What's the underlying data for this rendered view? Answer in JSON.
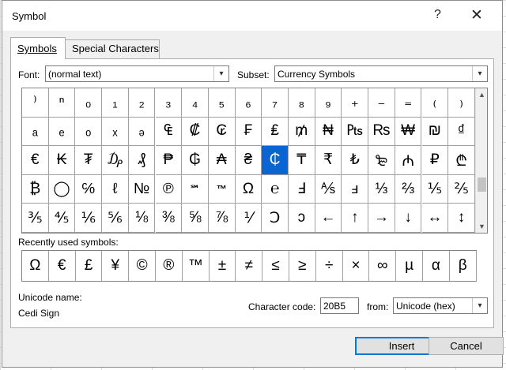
{
  "dialog": {
    "title": "Symbol",
    "help_glyph": "?",
    "close_glyph": "✕"
  },
  "tabs": [
    {
      "label": "Symbols",
      "active": true
    },
    {
      "label": "Special Characters",
      "active": false
    }
  ],
  "font": {
    "label": "Font:",
    "value": "(normal text)"
  },
  "subset": {
    "label": "Subset:",
    "value": "Currency Symbols"
  },
  "symbol_grid": {
    "rows": [
      [
        "⁾",
        "ⁿ",
        "₀",
        "₁",
        "₂",
        "₃",
        "₄",
        "₅",
        "₆",
        "₇",
        "₈",
        "₉",
        "₊",
        "₋",
        "₌",
        "₍",
        "₎"
      ],
      [
        "ₐ",
        "ₑ",
        "ₒ",
        "ₓ",
        "ₔ",
        "₠",
        "₡",
        "₢",
        "₣",
        "₤",
        "₥",
        "₦",
        "₧",
        "₨",
        "₩",
        "₪",
        "₫"
      ],
      [
        "€",
        "₭",
        "₮",
        "₯",
        "₰",
        "₱",
        "₲",
        "₳",
        "₴",
        "₵",
        "₸",
        "₹",
        "₺",
        "₻",
        "₼",
        "₽",
        "₾"
      ],
      [
        "₿",
        "◯",
        "℅",
        "ℓ",
        "№",
        "℗",
        "℠",
        "™",
        "Ω",
        "℮",
        "Ⅎ",
        "⅍",
        "ⅎ",
        "⅓",
        "⅔",
        "⅕",
        "⅖"
      ],
      [
        "⅗",
        "⅘",
        "⅙",
        "⅚",
        "⅛",
        "⅜",
        "⅝",
        "⅞",
        "⅟",
        "Ↄ",
        "ↄ",
        "←",
        "↑",
        "→",
        "↓",
        "↔",
        "↕"
      ]
    ],
    "selected": "₵"
  },
  "recent": {
    "label": "Recently used symbols:",
    "symbols": [
      "Ω",
      "€",
      "£",
      "¥",
      "©",
      "®",
      "™",
      "±",
      "≠",
      "≤",
      "≥",
      "÷",
      "×",
      "∞",
      "µ",
      "α",
      "β"
    ]
  },
  "unicode_name": {
    "label": "Unicode name:",
    "value": "Cedi Sign"
  },
  "character_code": {
    "label": "Character code:",
    "value": "20B5"
  },
  "from": {
    "label": "from:",
    "value": "Unicode (hex)"
  },
  "buttons": {
    "insert": "Insert",
    "cancel": "Cancel"
  },
  "colors": {
    "selection": "#0a64d2",
    "dialog_bg": "#f0f0f0",
    "default_button_border": "#0078d7"
  }
}
